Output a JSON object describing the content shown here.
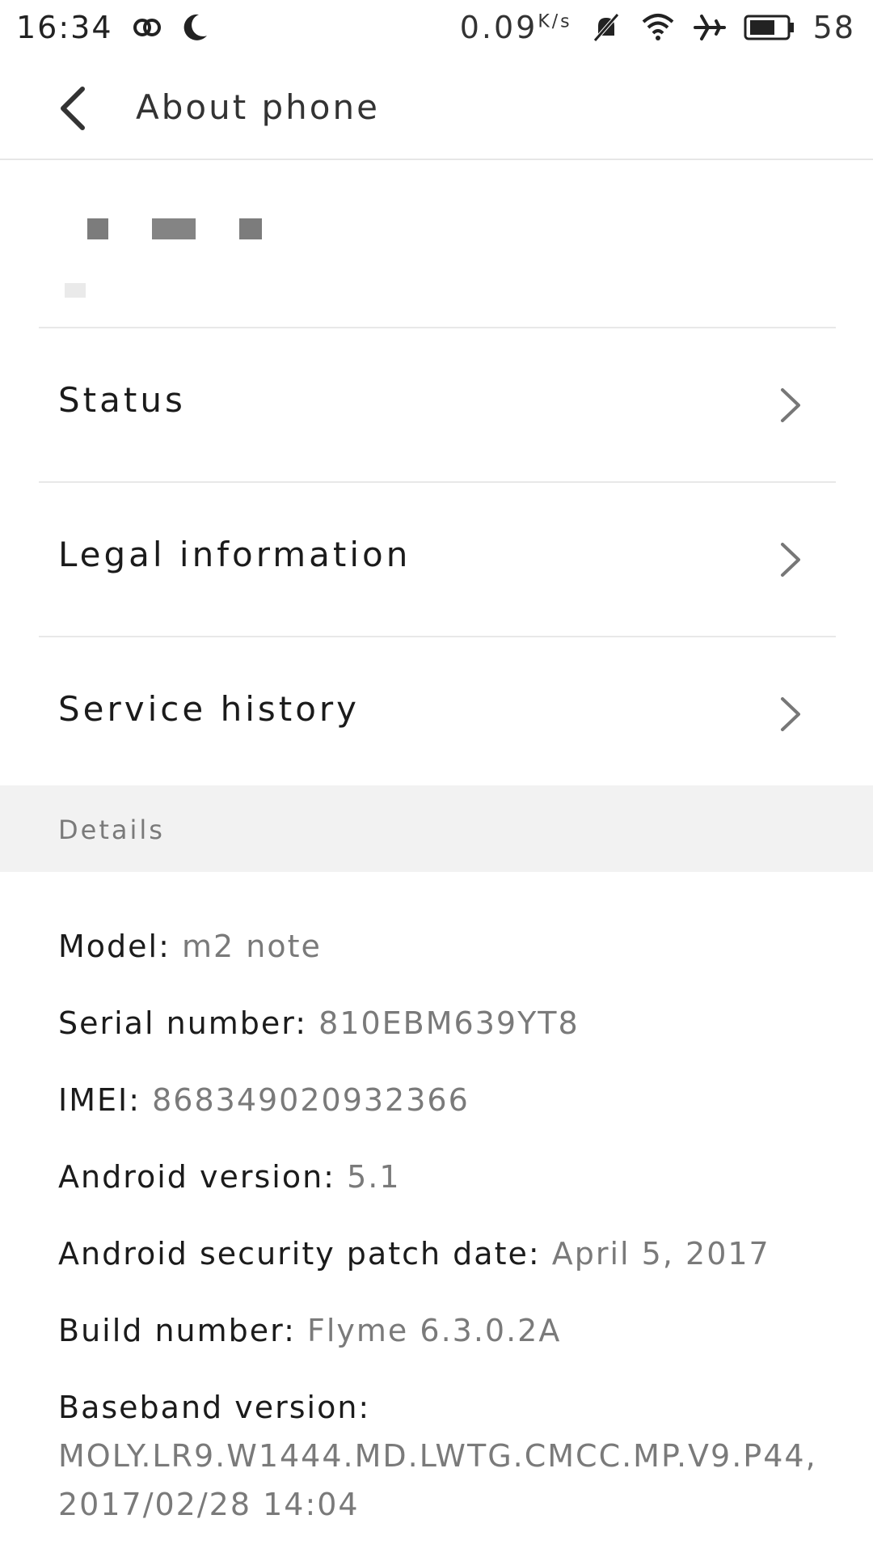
{
  "status_bar": {
    "time": "16:34",
    "net_speed_value": "0.09",
    "net_speed_unit": "K/s",
    "battery_percent": "58",
    "icons": [
      "link-icon",
      "moon-icon",
      "mute-icon",
      "wifi-icon",
      "airplane-icon",
      "battery-icon"
    ]
  },
  "header": {
    "title": "About phone"
  },
  "menu": {
    "items": [
      {
        "label": "Status"
      },
      {
        "label": "Legal information"
      },
      {
        "label": "Service history"
      }
    ]
  },
  "details": {
    "section_title": "Details",
    "rows": [
      {
        "label": "Model:",
        "value": "m2 note"
      },
      {
        "label": "Serial number:",
        "value": "810EBM639YT8"
      },
      {
        "label": "IMEI:",
        "value": "868349020932366"
      },
      {
        "label": "Android version:",
        "value": "5.1"
      },
      {
        "label": "Android security patch date:",
        "value": "April 5, 2017"
      },
      {
        "label": "Build number:",
        "value": "Flyme 6.3.0.2A"
      },
      {
        "label": "Baseband version:",
        "value": "MOLY.LR9.W1444.MD.LWTG.CMCC.MP.V9.P44, 2017/02/28 14:04"
      }
    ]
  }
}
